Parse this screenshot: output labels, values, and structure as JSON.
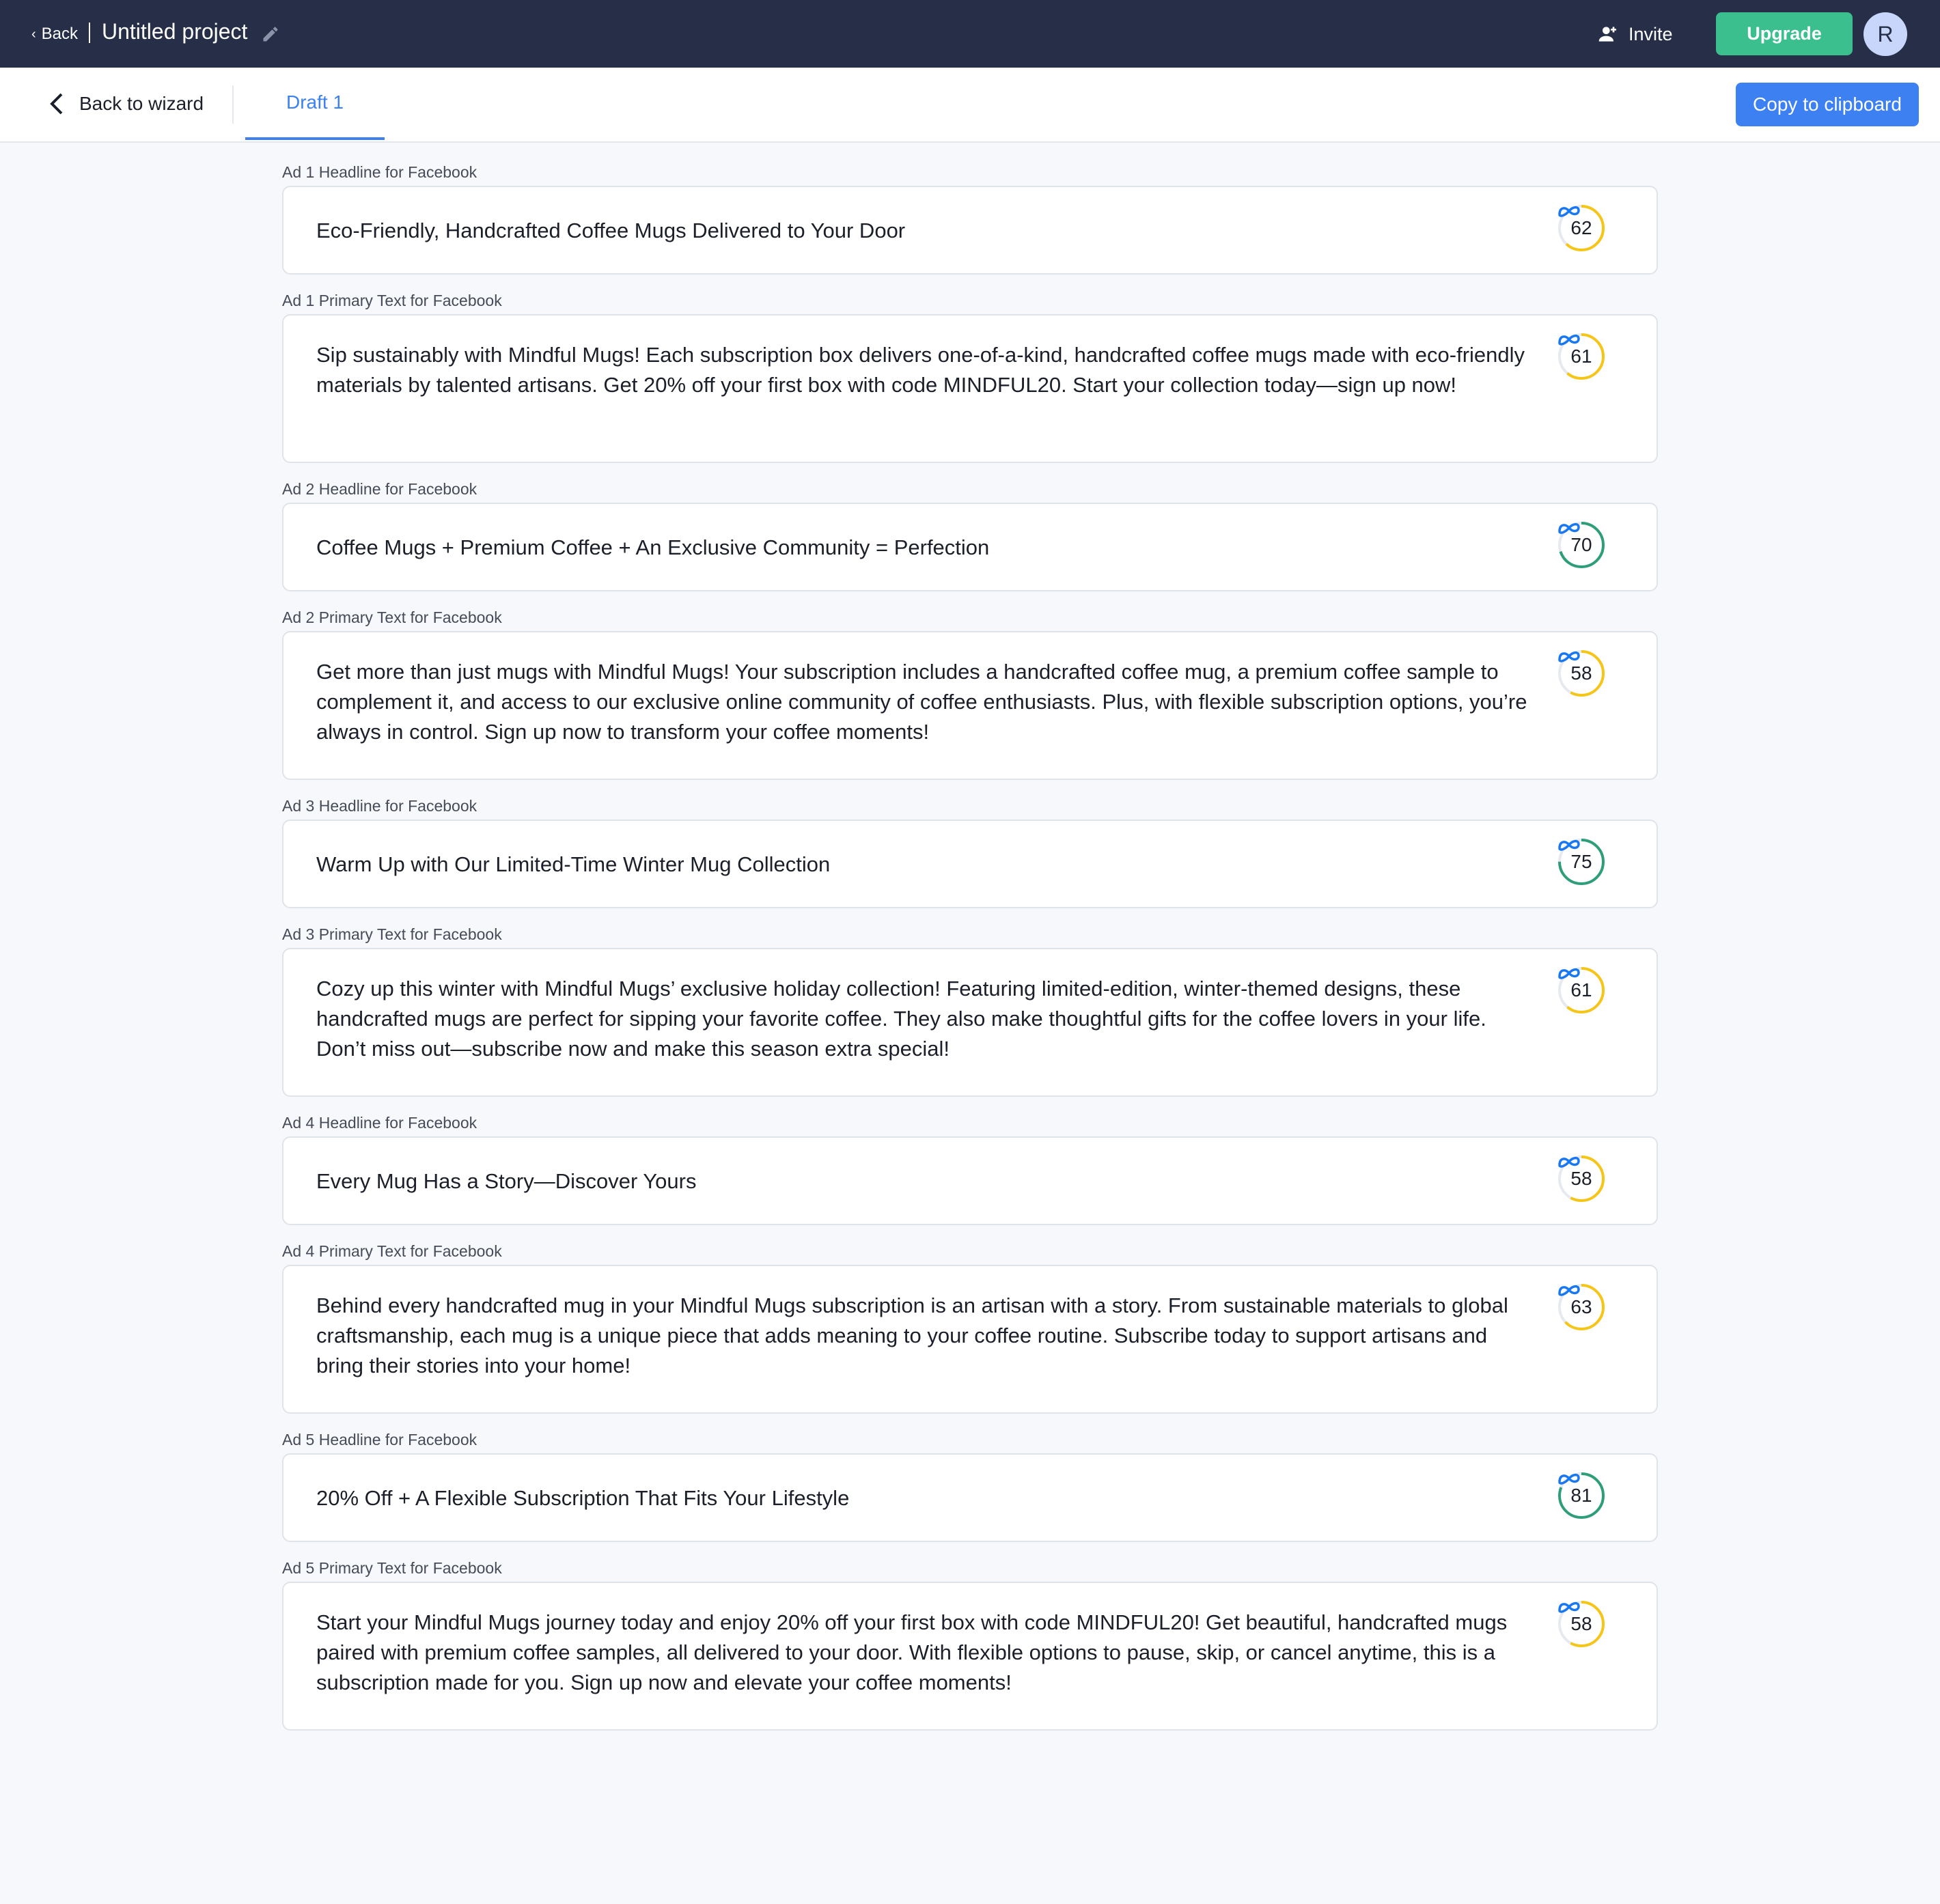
{
  "header": {
    "back_label": "Back",
    "project_title": "Untitled project",
    "invite_label": "Invite",
    "upgrade_label": "Upgrade",
    "avatar_initial": "R"
  },
  "toolbar": {
    "back_to_wizard_label": "Back to wizard",
    "tab_label": "Draft 1",
    "copy_label": "Copy to clipboard"
  },
  "colors": {
    "header_bg": "#262f47",
    "accent": "#3d80f1",
    "upgrade": "#3bbf8f",
    "score_yellow": "#f5c518",
    "score_green": "#2e9e7a",
    "meta_blue": "#1877f2"
  },
  "fields": [
    {
      "label": "Ad 1 Headline for Facebook",
      "text": "Eco-Friendly, Handcrafted Coffee Mugs Delivered to Your Door",
      "score": 62,
      "kind": "short"
    },
    {
      "label": "Ad 1 Primary Text for Facebook",
      "text": "Sip sustainably with Mindful Mugs! Each subscription box delivers one-of-a-kind, handcrafted coffee mugs made with eco-friendly materials by talented artisans. Get 20% off your first box with code MINDFUL20. Start your collection today—sign up now!",
      "score": 61,
      "kind": "long"
    },
    {
      "label": "Ad 2 Headline for Facebook",
      "text": "Coffee Mugs + Premium Coffee + An Exclusive Community = Perfection",
      "score": 70,
      "kind": "short"
    },
    {
      "label": "Ad 2 Primary Text for Facebook",
      "text": "Get more than just mugs with Mindful Mugs! Your subscription includes a handcrafted coffee mug, a premium coffee sample to complement it, and access to our exclusive online community of coffee enthusiasts. Plus, with flexible subscription options, you’re always in control. Sign up now to transform your coffee moments!",
      "score": 58,
      "kind": "long"
    },
    {
      "label": "Ad 3 Headline for Facebook",
      "text": "Warm Up with Our Limited-Time Winter Mug Collection",
      "score": 75,
      "kind": "short"
    },
    {
      "label": "Ad 3 Primary Text for Facebook",
      "text": "Cozy up this winter with Mindful Mugs’ exclusive holiday collection! Featuring limited-edition, winter-themed designs, these handcrafted mugs are perfect for sipping your favorite coffee. They also make thoughtful gifts for the coffee lovers in your life. Don’t miss out—subscribe now and make this season extra special!",
      "score": 61,
      "kind": "long"
    },
    {
      "label": "Ad 4 Headline for Facebook",
      "text": "Every Mug Has a Story—Discover Yours",
      "score": 58,
      "kind": "short"
    },
    {
      "label": "Ad 4 Primary Text for Facebook",
      "text": "Behind every handcrafted mug in your Mindful Mugs subscription is an artisan with a story. From sustainable materials to global craftsmanship, each mug is a unique piece that adds meaning to your coffee routine. Subscribe today to support artisans and bring their stories into your home!",
      "score": 63,
      "kind": "long"
    },
    {
      "label": "Ad 5 Headline for Facebook",
      "text": "20% Off + A Flexible Subscription That Fits Your Lifestyle",
      "score": 81,
      "kind": "short"
    },
    {
      "label": "Ad 5 Primary Text for Facebook",
      "text": "Start your Mindful Mugs journey today and enjoy 20% off your first box with code MINDFUL20! Get beautiful, handcrafted mugs paired with premium coffee samples, all delivered to your door. With flexible options to pause, skip, or cancel anytime, this is a subscription made for you. Sign up now and elevate your coffee moments!",
      "score": 58,
      "kind": "long"
    }
  ]
}
